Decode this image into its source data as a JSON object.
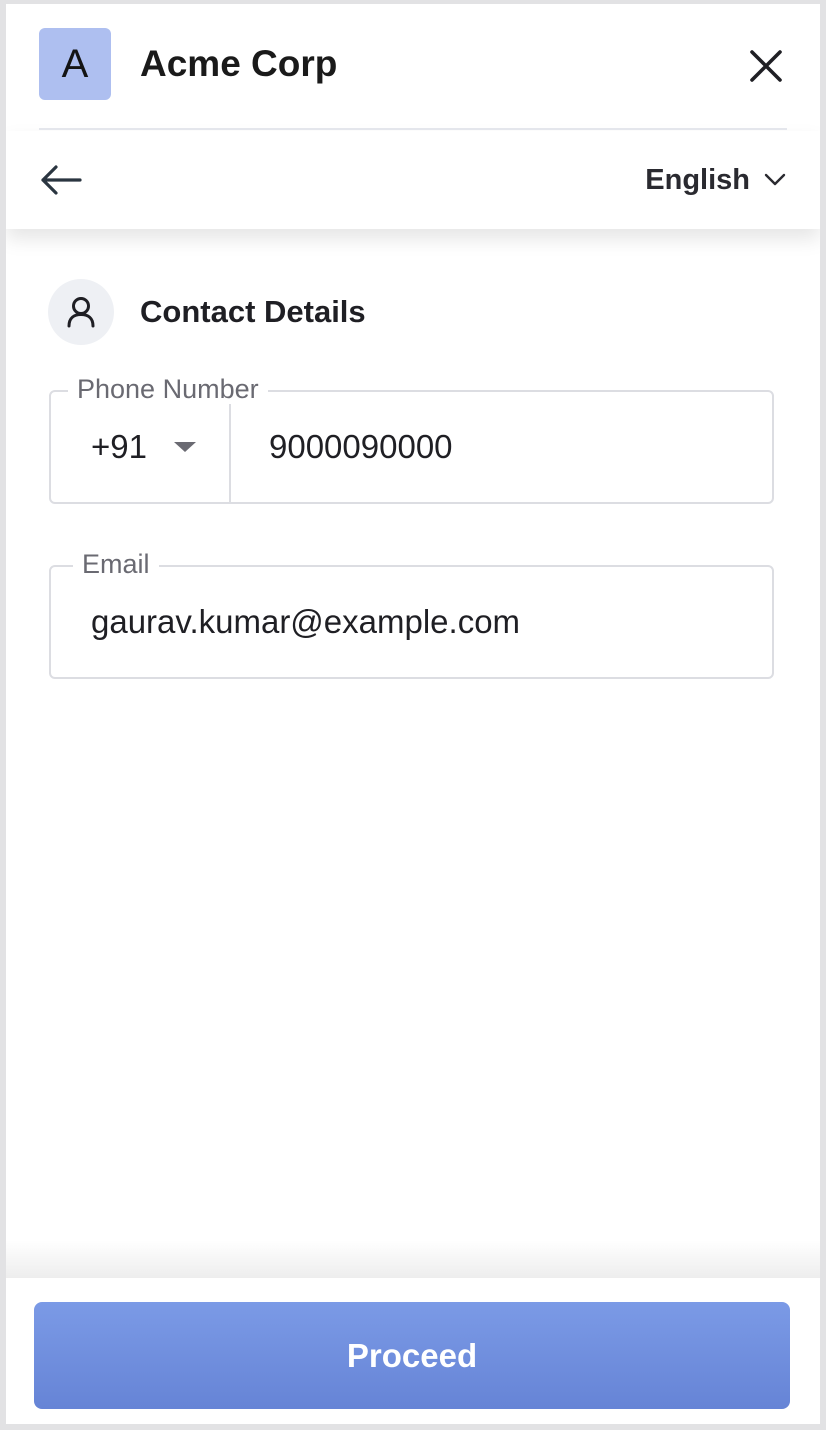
{
  "header": {
    "logo_letter": "A",
    "merchant_name": "Acme Corp",
    "logo_color": "#aebff0"
  },
  "navbar": {
    "language": "English"
  },
  "section": {
    "title": "Contact Details",
    "icon": "user-icon"
  },
  "phone": {
    "label": "Phone Number",
    "country_code": "+91",
    "value": "9000090000"
  },
  "email": {
    "label": "Email",
    "value": "gaurav.kumar@example.com"
  },
  "footer": {
    "proceed_label": "Proceed",
    "button_color": "#7390e0"
  }
}
